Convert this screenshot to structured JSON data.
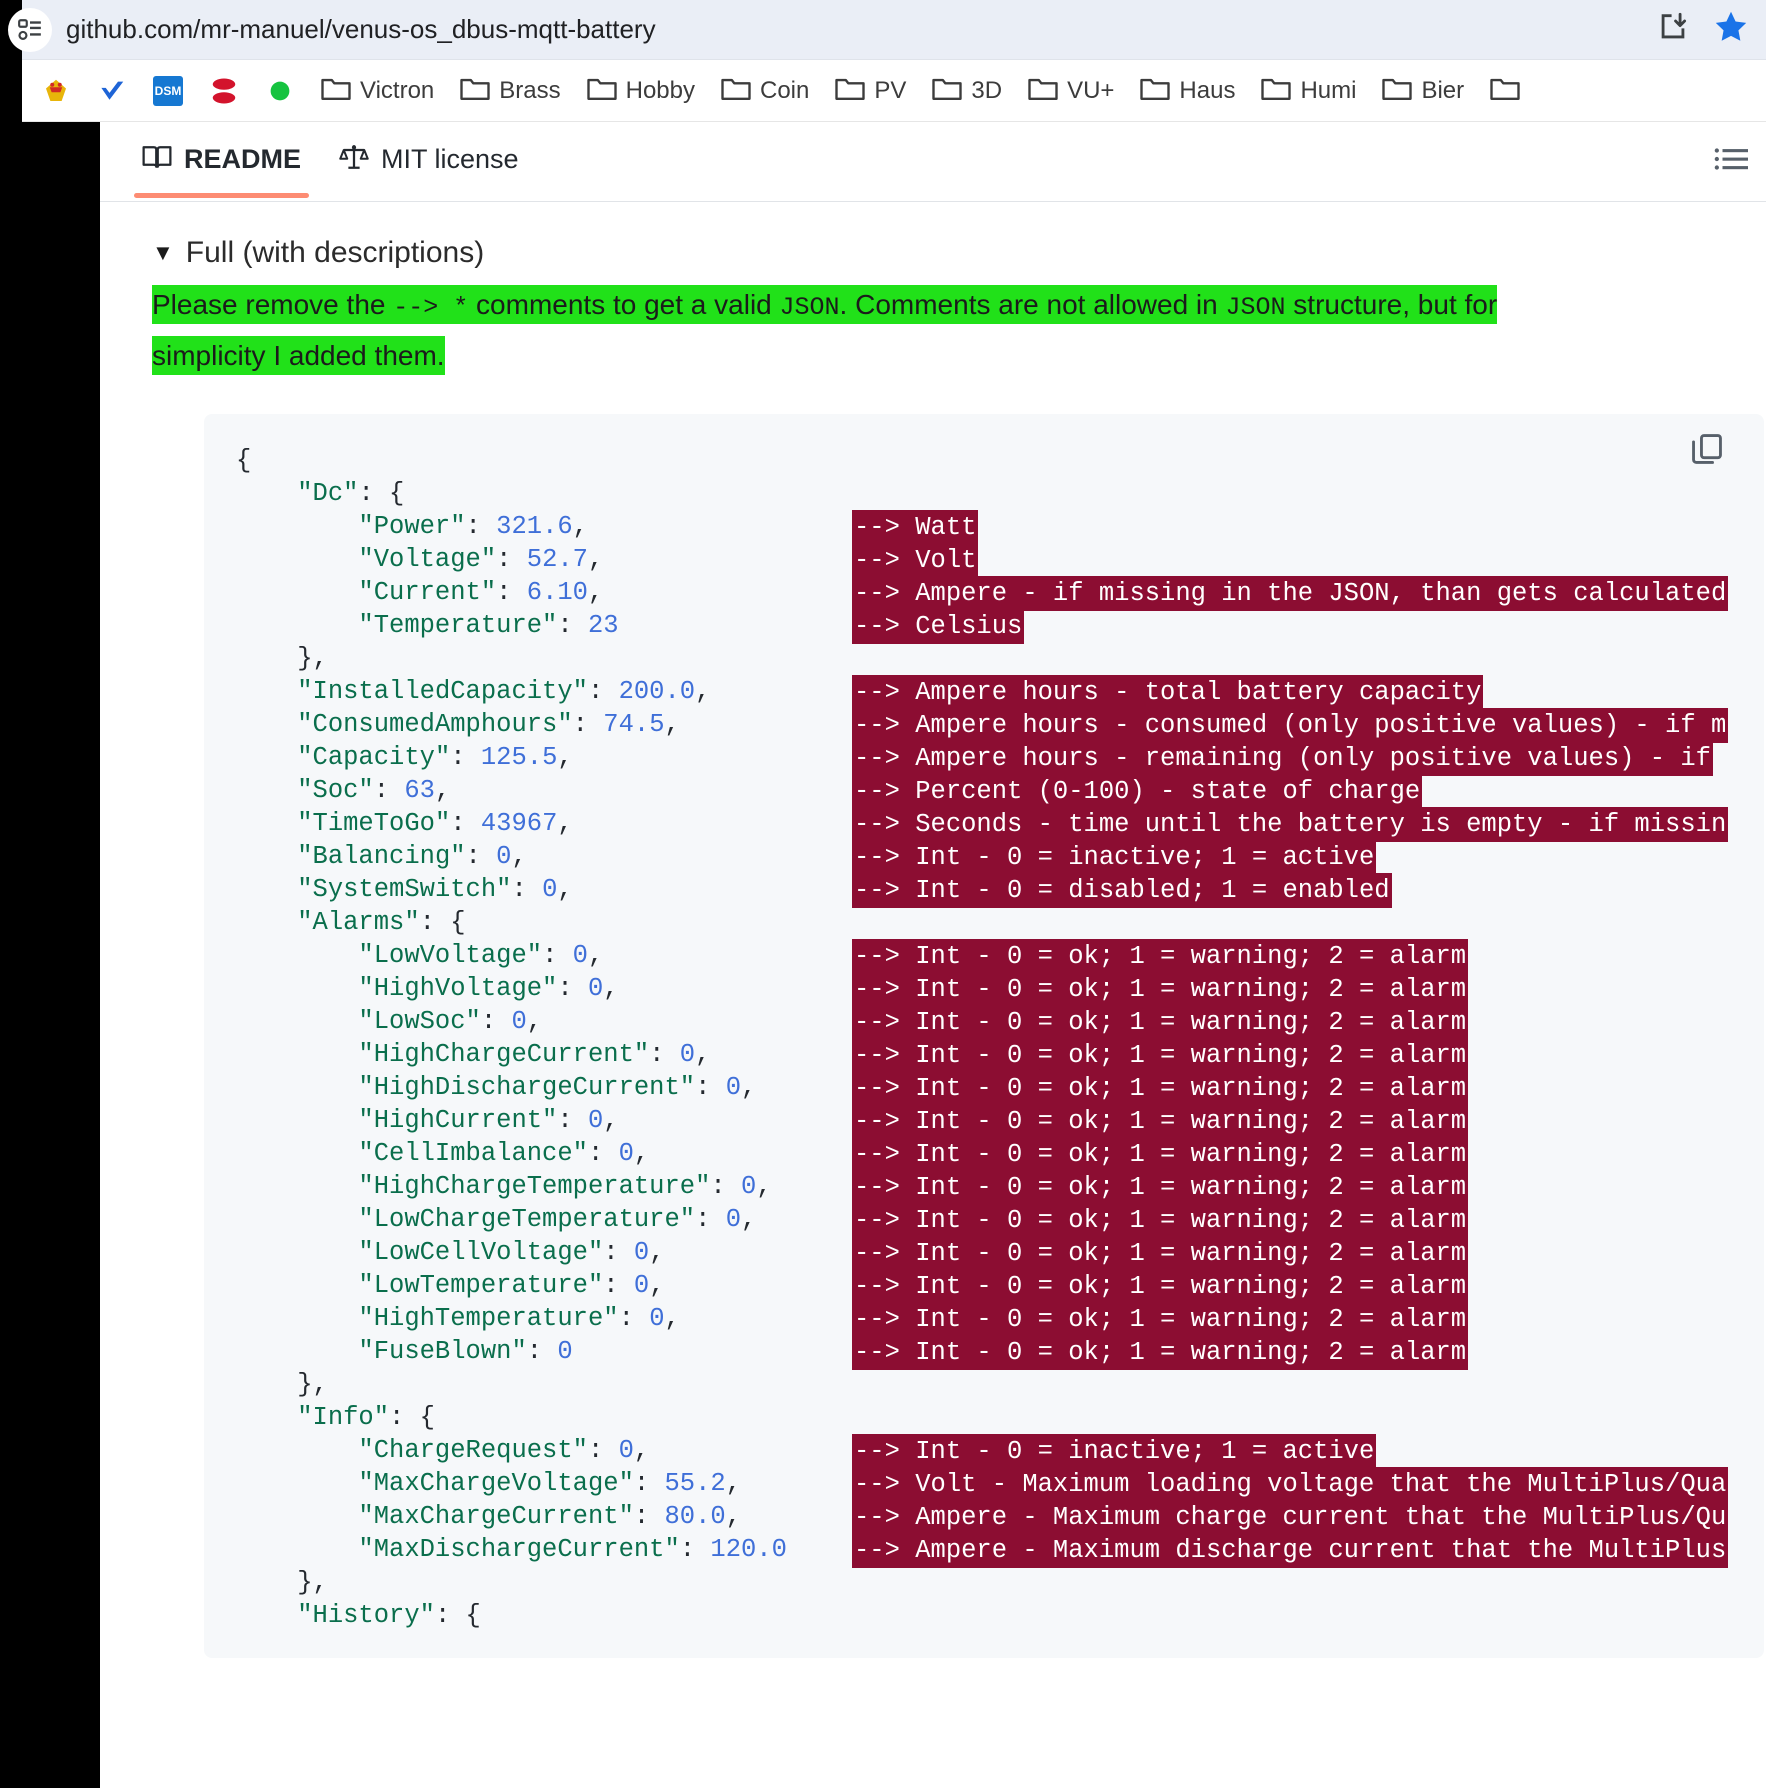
{
  "browser": {
    "url": "github.com/mr-manuel/venus-os_dbus-mqtt-battery",
    "site_icon": "list-page-icon",
    "install_icon": "install-app-icon",
    "bookmark_star_icon": "star-filled-icon",
    "bookmarks": [
      {
        "label": "",
        "icon": "mhp-favicon",
        "color": "#e03b2f"
      },
      {
        "label": "",
        "icon": "check-blue-favicon",
        "color": "#1e64d6"
      },
      {
        "label": "",
        "icon": "dsm-favicon",
        "color": "#1678d2"
      },
      {
        "label": "",
        "icon": "austria-favicon",
        "color": "#d3132c"
      },
      {
        "label": "",
        "icon": "green-dot-favicon",
        "color": "#16c340"
      },
      {
        "label": "Victron",
        "icon": "folder-icon",
        "color": ""
      },
      {
        "label": "Brass",
        "icon": "folder-icon",
        "color": ""
      },
      {
        "label": "Hobby",
        "icon": "folder-icon",
        "color": ""
      },
      {
        "label": "Coin",
        "icon": "folder-icon",
        "color": ""
      },
      {
        "label": "PV",
        "icon": "folder-icon",
        "color": ""
      },
      {
        "label": "3D",
        "icon": "folder-icon",
        "color": ""
      },
      {
        "label": "VU+",
        "icon": "folder-icon",
        "color": ""
      },
      {
        "label": "Haus",
        "icon": "folder-icon",
        "color": ""
      },
      {
        "label": "Humi",
        "icon": "folder-icon",
        "color": ""
      },
      {
        "label": "Bier",
        "icon": "folder-icon",
        "color": ""
      },
      {
        "label": "",
        "icon": "folder-icon",
        "color": ""
      }
    ]
  },
  "repo": {
    "tabs": [
      {
        "label": "README",
        "icon": "book-icon",
        "active": true
      },
      {
        "label": "MIT license",
        "icon": "scale-icon",
        "active": false
      }
    ],
    "outline_icon": "list-unordered-icon"
  },
  "readme": {
    "details_summary": "Full (with descriptions)",
    "triangle": "▼",
    "note": {
      "part1": "Please remove the ",
      "code1": "--> *",
      "part2": " comments to get a valid ",
      "code2": "JSON",
      "part3": ". Comments are not allowed in ",
      "code3": "JSON",
      "part4": " structure, but for simplicity I added them."
    },
    "copy_icon": "copy-icon"
  },
  "code": {
    "lines": [
      {
        "indent": 0,
        "key": "",
        "text": "{",
        "comment": ""
      },
      {
        "indent": 1,
        "key": "\"Dc\"",
        "text": ": {",
        "comment": ""
      },
      {
        "indent": 2,
        "key": "\"Power\"",
        "text": ": ",
        "value": "321.6",
        "tail": ",",
        "comment": "--> Watt"
      },
      {
        "indent": 2,
        "key": "\"Voltage\"",
        "text": ": ",
        "value": "52.7",
        "tail": ",",
        "comment": "--> Volt"
      },
      {
        "indent": 2,
        "key": "\"Current\"",
        "text": ": ",
        "value": "6.10",
        "tail": ",",
        "comment": "--> Ampere - if missing in the JSON, than gets calculated"
      },
      {
        "indent": 2,
        "key": "\"Temperature\"",
        "text": ": ",
        "value": "23",
        "tail": "",
        "comment": "--> Celsius"
      },
      {
        "indent": 1,
        "key": "",
        "text": "},",
        "comment": ""
      },
      {
        "indent": 1,
        "key": "\"InstalledCapacity\"",
        "text": ": ",
        "value": "200.0",
        "tail": ",",
        "comment": "--> Ampere hours - total battery capacity"
      },
      {
        "indent": 1,
        "key": "\"ConsumedAmphours\"",
        "text": ": ",
        "value": "74.5",
        "tail": ",",
        "comment": "--> Ampere hours - consumed (only positive values) - if m"
      },
      {
        "indent": 1,
        "key": "\"Capacity\"",
        "text": ": ",
        "value": "125.5",
        "tail": ",",
        "comment": "--> Ampere hours - remaining (only positive values) - if"
      },
      {
        "indent": 1,
        "key": "\"Soc\"",
        "text": ": ",
        "value": "63",
        "tail": ",",
        "comment": "--> Percent (0-100) - state of charge"
      },
      {
        "indent": 1,
        "key": "\"TimeToGo\"",
        "text": ": ",
        "value": "43967",
        "tail": ",",
        "comment": "--> Seconds - time until the battery is empty - if missin"
      },
      {
        "indent": 1,
        "key": "\"Balancing\"",
        "text": ": ",
        "value": "0",
        "tail": ",",
        "comment": "--> Int - 0 = inactive; 1 = active"
      },
      {
        "indent": 1,
        "key": "\"SystemSwitch\"",
        "text": ": ",
        "value": "0",
        "tail": ",",
        "comment": "--> Int - 0 = disabled; 1 = enabled"
      },
      {
        "indent": 1,
        "key": "\"Alarms\"",
        "text": ": {",
        "comment": ""
      },
      {
        "indent": 2,
        "key": "\"LowVoltage\"",
        "text": ": ",
        "value": "0",
        "tail": ",",
        "comment": "--> Int - 0 = ok; 1 = warning; 2 = alarm"
      },
      {
        "indent": 2,
        "key": "\"HighVoltage\"",
        "text": ": ",
        "value": "0",
        "tail": ",",
        "comment": "--> Int - 0 = ok; 1 = warning; 2 = alarm"
      },
      {
        "indent": 2,
        "key": "\"LowSoc\"",
        "text": ": ",
        "value": "0",
        "tail": ",",
        "comment": "--> Int - 0 = ok; 1 = warning; 2 = alarm"
      },
      {
        "indent": 2,
        "key": "\"HighChargeCurrent\"",
        "text": ": ",
        "value": "0",
        "tail": ",",
        "comment": "--> Int - 0 = ok; 1 = warning; 2 = alarm"
      },
      {
        "indent": 2,
        "key": "\"HighDischargeCurrent\"",
        "text": ": ",
        "value": "0",
        "tail": ",",
        "comment": "--> Int - 0 = ok; 1 = warning; 2 = alarm"
      },
      {
        "indent": 2,
        "key": "\"HighCurrent\"",
        "text": ": ",
        "value": "0",
        "tail": ",",
        "comment": "--> Int - 0 = ok; 1 = warning; 2 = alarm"
      },
      {
        "indent": 2,
        "key": "\"CellImbalance\"",
        "text": ": ",
        "value": "0",
        "tail": ",",
        "comment": "--> Int - 0 = ok; 1 = warning; 2 = alarm"
      },
      {
        "indent": 2,
        "key": "\"HighChargeTemperature\"",
        "text": ": ",
        "value": "0",
        "tail": ",",
        "comment": "--> Int - 0 = ok; 1 = warning; 2 = alarm"
      },
      {
        "indent": 2,
        "key": "\"LowChargeTemperature\"",
        "text": ": ",
        "value": "0",
        "tail": ",",
        "comment": "--> Int - 0 = ok; 1 = warning; 2 = alarm"
      },
      {
        "indent": 2,
        "key": "\"LowCellVoltage\"",
        "text": ": ",
        "value": "0",
        "tail": ",",
        "comment": "--> Int - 0 = ok; 1 = warning; 2 = alarm"
      },
      {
        "indent": 2,
        "key": "\"LowTemperature\"",
        "text": ": ",
        "value": "0",
        "tail": ",",
        "comment": "--> Int - 0 = ok; 1 = warning; 2 = alarm"
      },
      {
        "indent": 2,
        "key": "\"HighTemperature\"",
        "text": ": ",
        "value": "0",
        "tail": ",",
        "comment": "--> Int - 0 = ok; 1 = warning; 2 = alarm"
      },
      {
        "indent": 2,
        "key": "\"FuseBlown\"",
        "text": ": ",
        "value": "0",
        "tail": "",
        "comment": "--> Int - 0 = ok; 1 = warning; 2 = alarm"
      },
      {
        "indent": 1,
        "key": "",
        "text": "},",
        "comment": ""
      },
      {
        "indent": 1,
        "key": "\"Info\"",
        "text": ": {",
        "comment": ""
      },
      {
        "indent": 2,
        "key": "\"ChargeRequest\"",
        "text": ": ",
        "value": "0",
        "tail": ",",
        "comment": "--> Int - 0 = inactive; 1 = active"
      },
      {
        "indent": 2,
        "key": "\"MaxChargeVoltage\"",
        "text": ": ",
        "value": "55.2",
        "tail": ",",
        "comment": "--> Volt - Maximum loading voltage that the MultiPlus/Qua"
      },
      {
        "indent": 2,
        "key": "\"MaxChargeCurrent\"",
        "text": ": ",
        "value": "80.0",
        "tail": ",",
        "comment": "--> Ampere - Maximum charge current that the MultiPlus/Qu"
      },
      {
        "indent": 2,
        "key": "\"MaxDischargeCurrent\"",
        "text": ": ",
        "value": "120.0",
        "tail": "",
        "comment": "--> Ampere - Maximum discharge current that the MultiPlus"
      },
      {
        "indent": 1,
        "key": "",
        "text": "},",
        "comment": ""
      },
      {
        "indent": 1,
        "key": "\"History\"",
        "text": ": {",
        "comment": ""
      }
    ]
  },
  "colors": {
    "highlight_green": "#21e119",
    "comment_bg": "#8c0d32",
    "json_key": "#0a6e4c",
    "json_value": "#3f6fd8",
    "tab_underline": "#fd8c73",
    "code_bg": "#f6f8fa"
  }
}
